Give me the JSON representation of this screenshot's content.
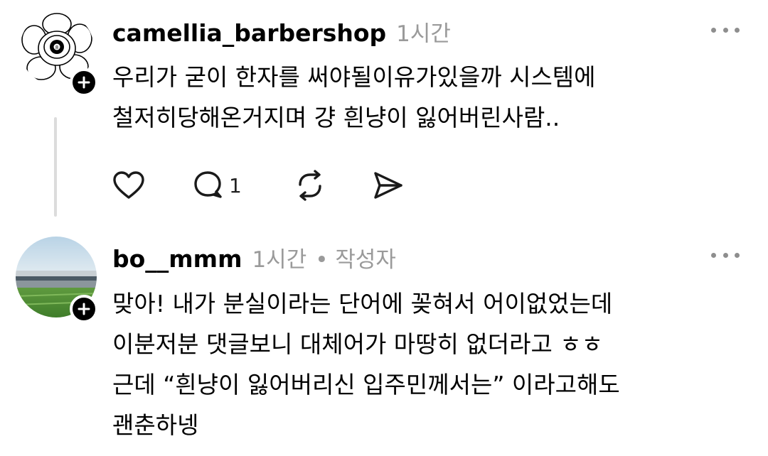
{
  "posts": [
    {
      "username": "camellia_barbershop",
      "time": "1시간",
      "lines": [
        "우리가 굳이 한자를 써야될이유가있을까 시스템에",
        "철저히당해온거지며 걍 흰냥이 잃어버린사람.."
      ],
      "actions": {
        "reply_count": "1"
      },
      "icons": [
        "heart-icon",
        "comment-icon",
        "repost-icon",
        "share-icon",
        "more-icon",
        "plus-icon"
      ]
    },
    {
      "username": "bo__mmm",
      "time": "1시간",
      "author_tag": "• 작성자",
      "lines": [
        "맞아! 내가 분실이라는 단어에 꽂혀서 어이없었는데",
        "이분저분 댓글보니 대체어가 마땅히 없더라고 ㅎㅎ",
        "근데 “흰냥이 잃어버리신 입주민께서는” 이라고해도",
        "괜춘하넹"
      ],
      "icons": [
        "more-icon",
        "plus-icon"
      ]
    }
  ]
}
